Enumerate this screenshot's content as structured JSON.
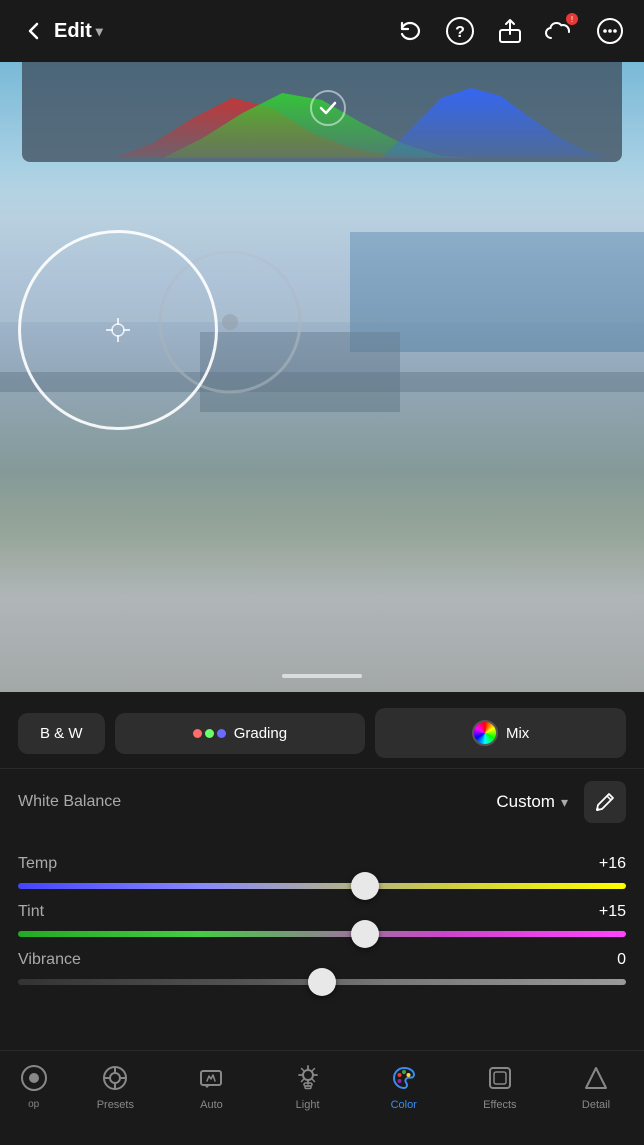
{
  "header": {
    "back_label": "‹",
    "title": "Edit",
    "dropdown_icon": "▾",
    "undo_label": "↩",
    "help_label": "?",
    "share_label": "↑",
    "cloud_badge": "!",
    "more_label": "•••"
  },
  "tabs": {
    "bw_label": "B & W",
    "grading_label": "Grading",
    "mix_label": "Mix"
  },
  "white_balance": {
    "label": "White Balance",
    "value": "Custom",
    "dropdown_icon": "▾"
  },
  "sliders": {
    "temp": {
      "label": "Temp",
      "value": "+16",
      "position_pct": 57
    },
    "tint": {
      "label": "Tint",
      "value": "+15",
      "position_pct": 57
    },
    "vibrance": {
      "label": "Vibrance",
      "value": "0",
      "position_pct": 50
    }
  },
  "bottom_nav": {
    "items": [
      {
        "id": "op",
        "label": "op",
        "icon": "op"
      },
      {
        "id": "presets",
        "label": "Presets",
        "icon": "presets"
      },
      {
        "id": "auto",
        "label": "Auto",
        "icon": "auto"
      },
      {
        "id": "light",
        "label": "Light",
        "icon": "light"
      },
      {
        "id": "color",
        "label": "Color",
        "icon": "color",
        "active": true
      },
      {
        "id": "effects",
        "label": "Effects",
        "icon": "effects"
      },
      {
        "id": "detail",
        "label": "Detail",
        "icon": "detail"
      }
    ]
  }
}
